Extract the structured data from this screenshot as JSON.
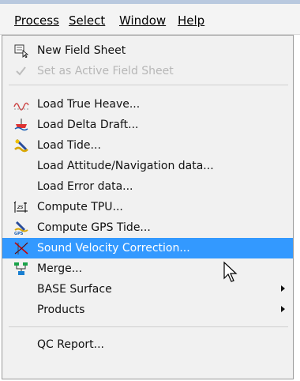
{
  "menubar": {
    "items": [
      {
        "label": "Process",
        "mnemonic_index": 0
      },
      {
        "label": "Select",
        "mnemonic_index": 0
      },
      {
        "label": "Window",
        "mnemonic_index": 0
      },
      {
        "label": "Help",
        "mnemonic_index": 0
      }
    ]
  },
  "menu": {
    "new_field_sheet": "New Field Sheet",
    "set_active_field_sheet": "Set as Active Field Sheet",
    "load_true_heave": "Load True Heave...",
    "load_delta_draft": "Load Delta Draft...",
    "load_tide": "Load Tide...",
    "load_attitude": "Load Attitude/Navigation data...",
    "load_error": "Load Error data...",
    "compute_tpu": "Compute TPU...",
    "compute_gps_tide": "Compute GPS Tide...",
    "sound_velocity": "Sound Velocity Correction...",
    "merge": "Merge...",
    "base_surface": "BASE Surface",
    "products": "Products",
    "qc_report": "QC Report..."
  },
  "colors": {
    "selection": "#3399ff",
    "menu_bg": "#f1f1f1",
    "disabled_text": "#b7b7b7"
  },
  "icons": {
    "new_field_sheet": "field-sheet-icon",
    "load_true_heave": "heave-wave-icon",
    "load_delta_draft": "draft-icon",
    "load_tide": "tide-icon",
    "compute_tpu": "tpu-icon",
    "compute_gps_tide": "gps-tide-icon",
    "sound_velocity": "sound-velocity-icon",
    "merge": "merge-icon"
  }
}
